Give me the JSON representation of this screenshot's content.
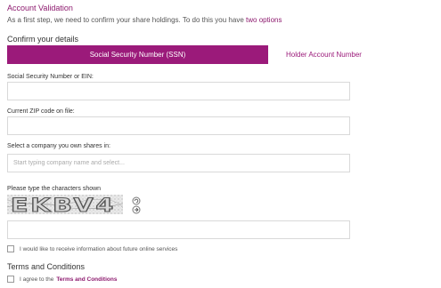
{
  "header": {
    "title": "Account Validation",
    "intro_text": "As a first step, we need to confirm your share holdings. To do this you have",
    "intro_link": "two options"
  },
  "confirm": {
    "heading": "Confirm your details",
    "tabs": [
      {
        "label": "Social Security Number (SSN)",
        "active": true
      },
      {
        "label": "Holder Account Number",
        "active": false
      }
    ]
  },
  "form": {
    "ssn_label": "Social Security Number or EIN:",
    "zip_label": "Current ZIP code on file:",
    "company_label": "Select a company you own shares in:",
    "company_placeholder": "Start typing company name and select...",
    "captcha_label": "Please type the characters shown",
    "captcha_text": "EKBV4"
  },
  "options": {
    "newsletter_label": "I would like to receive information about future online services"
  },
  "terms": {
    "heading": "Terms and Conditions",
    "agree_text": "I agree to the",
    "link_text": "Terms and Conditions"
  },
  "colors": {
    "accent": "#9b1a7a"
  }
}
